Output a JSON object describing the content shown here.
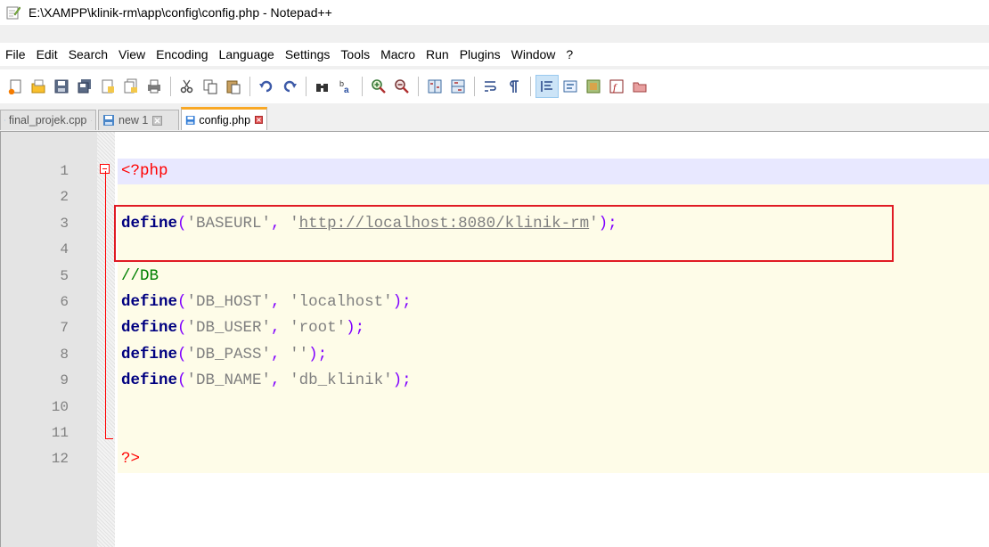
{
  "window": {
    "title": "E:\\XAMPP\\klinik-rm\\app\\config\\config.php - Notepad++"
  },
  "menu": [
    "File",
    "Edit",
    "Search",
    "View",
    "Encoding",
    "Language",
    "Settings",
    "Tools",
    "Macro",
    "Run",
    "Plugins",
    "Window",
    "?"
  ],
  "toolbar": {
    "icons": [
      "new-file-icon",
      "open-file-icon",
      "save-icon",
      "save-all-icon",
      "close-icon",
      "close-all-icon",
      "print-icon",
      "cut-icon",
      "copy-icon",
      "paste-icon",
      "undo-icon",
      "redo-icon",
      "find-icon",
      "replace-icon",
      "zoom-in-icon",
      "zoom-out-icon",
      "sync-vertical-icon",
      "sync-horizontal-icon",
      "word-wrap-icon",
      "show-all-chars-icon",
      "indent-guide-icon",
      "user-language-icon",
      "document-map-icon",
      "function-list-icon",
      "folder-workspace-icon"
    ]
  },
  "tabs": [
    {
      "label": "final_projek.cpp",
      "active": false
    },
    {
      "label": "new 1",
      "active": false
    },
    {
      "label": "config.php",
      "active": true
    }
  ],
  "editor": {
    "line_numbers": [
      "1",
      "2",
      "3",
      "4",
      "5",
      "6",
      "7",
      "8",
      "9",
      "10",
      "11",
      "12"
    ],
    "lines": [
      [
        {
          "t": "php",
          "v": "<?php"
        }
      ],
      [],
      [
        {
          "t": "kw",
          "v": "define"
        },
        {
          "t": "pn",
          "v": "("
        },
        {
          "t": "str",
          "v": "'BASEURL'"
        },
        {
          "t": "pn",
          "v": ","
        },
        {
          "t": "plain",
          "v": " "
        },
        {
          "t": "str",
          "v": "'"
        },
        {
          "t": "url",
          "v": "http://localhost:8080/klinik-rm"
        },
        {
          "t": "str",
          "v": "'"
        },
        {
          "t": "pn",
          "v": ");"
        }
      ],
      [],
      [
        {
          "t": "cmt",
          "v": "//DB"
        }
      ],
      [
        {
          "t": "kw",
          "v": "define"
        },
        {
          "t": "pn",
          "v": "("
        },
        {
          "t": "str",
          "v": "'DB_HOST'"
        },
        {
          "t": "pn",
          "v": ","
        },
        {
          "t": "plain",
          "v": " "
        },
        {
          "t": "str",
          "v": "'localhost'"
        },
        {
          "t": "pn",
          "v": ");"
        }
      ],
      [
        {
          "t": "kw",
          "v": "define"
        },
        {
          "t": "pn",
          "v": "("
        },
        {
          "t": "str",
          "v": "'DB_USER'"
        },
        {
          "t": "pn",
          "v": ","
        },
        {
          "t": "plain",
          "v": " "
        },
        {
          "t": "str",
          "v": "'root'"
        },
        {
          "t": "pn",
          "v": ");"
        }
      ],
      [
        {
          "t": "kw",
          "v": "define"
        },
        {
          "t": "pn",
          "v": "("
        },
        {
          "t": "str",
          "v": "'DB_PASS'"
        },
        {
          "t": "pn",
          "v": ","
        },
        {
          "t": "plain",
          "v": " "
        },
        {
          "t": "str",
          "v": "''"
        },
        {
          "t": "pn",
          "v": ");"
        }
      ],
      [
        {
          "t": "kw",
          "v": "define"
        },
        {
          "t": "pn",
          "v": "("
        },
        {
          "t": "str",
          "v": "'DB_NAME'"
        },
        {
          "t": "pn",
          "v": ","
        },
        {
          "t": "plain",
          "v": " "
        },
        {
          "t": "str",
          "v": "'db_klinik'"
        },
        {
          "t": "pn",
          "v": ");"
        }
      ],
      [],
      [],
      [
        {
          "t": "php",
          "v": "?>"
        }
      ]
    ],
    "current_line": 1
  },
  "colors": {
    "keyword": "#000080",
    "operator": "#8000ff",
    "string": "#808080",
    "php_tag": "#ff0000",
    "comment": "#008000",
    "annotation_box": "#e01b24",
    "active_tab_accent": "#f9a825"
  }
}
